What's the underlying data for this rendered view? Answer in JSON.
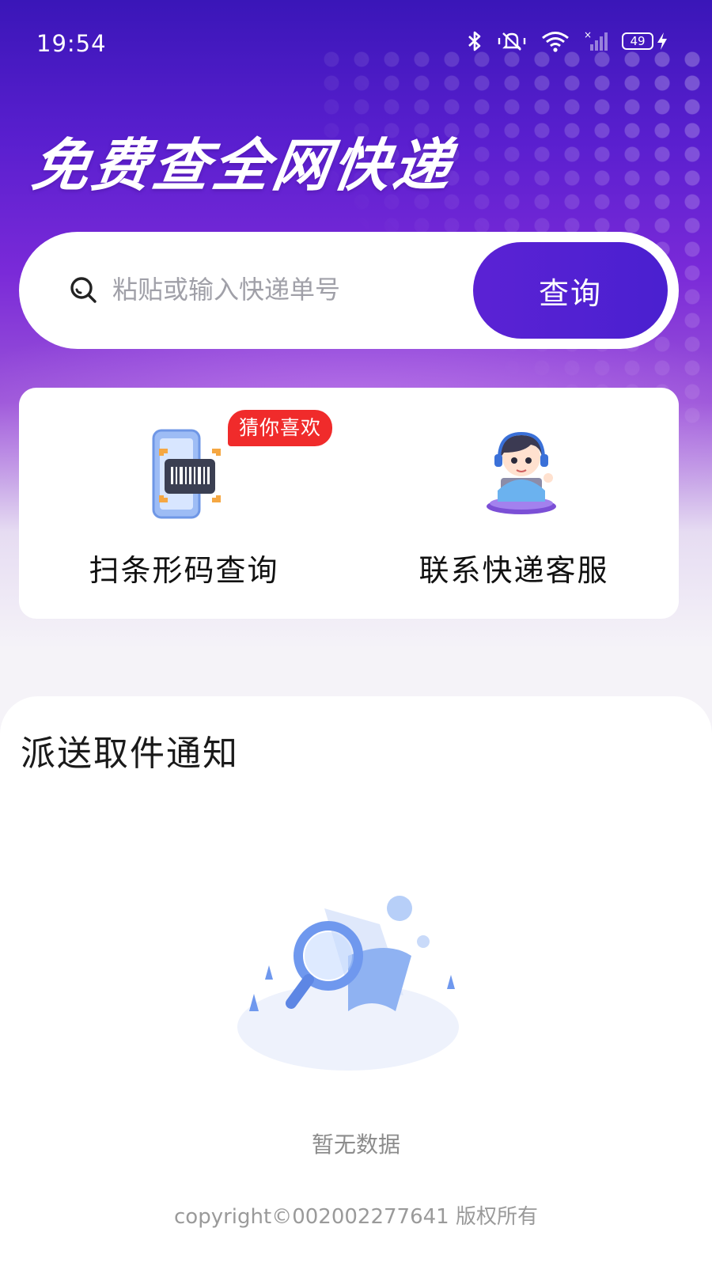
{
  "status_bar": {
    "time": "19:54",
    "battery": "49",
    "icons": [
      "bluetooth-icon",
      "mute-icon",
      "wifi-icon",
      "signal-icon",
      "battery-icon",
      "charging-icon"
    ]
  },
  "hero": {
    "headline": "免费查全网快递"
  },
  "search": {
    "placeholder": "粘贴或输入快递单号",
    "value": "",
    "button_label": "查询"
  },
  "actions": {
    "scan": {
      "label": "扫条形码查询",
      "badge": "猜你喜欢",
      "icon": "barcode-scan-icon"
    },
    "service": {
      "label": "联系快递客服",
      "icon": "customer-service-icon"
    }
  },
  "notices": {
    "title": "派送取件通知",
    "empty_text": "暂无数据"
  },
  "footer": {
    "copyright": "copyright©002002277641 版权所有"
  },
  "colors": {
    "primary": "#4a20d0",
    "badge": "#f02b2b",
    "hero_top": "#3a16b8"
  }
}
